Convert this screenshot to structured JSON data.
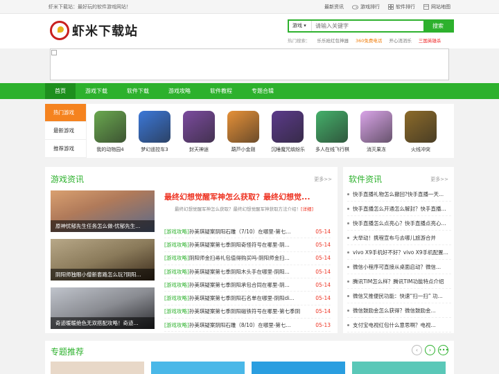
{
  "topbar": {
    "welcome": "虾米下载站：最好玩的软件游戏网站！",
    "links": [
      {
        "label": "最新资讯",
        "icon": "none"
      },
      {
        "label": "游戏排行",
        "icon": "gamepad-icon"
      },
      {
        "label": "软件排行",
        "icon": "apps-icon"
      },
      {
        "label": "网站地图",
        "icon": "sitemap-icon"
      }
    ]
  },
  "header": {
    "logo_text": "虾米下载站",
    "search": {
      "category": "游戏",
      "placeholder": "请输入关键字",
      "button": "搜索"
    },
    "hot": {
      "label": "热门搜索：",
      "words": [
        "乐乐抢红包神器",
        "360免费电话",
        "开心消消乐",
        "三国英雄杀"
      ]
    }
  },
  "nav": {
    "items": [
      "首页",
      "游戏下载",
      "软件下载",
      "游戏攻略",
      "软件教程",
      "专题合辑"
    ],
    "active": 0
  },
  "games_section": {
    "tabs": [
      "热门游戏",
      "最新游戏",
      "推荐游戏"
    ],
    "active_tab": 0,
    "games": [
      {
        "name": "我的动物园4",
        "color": "#6aa84f"
      },
      {
        "name": "梦幻遥控车3",
        "color": "#3c78d8"
      },
      {
        "name": "封天神途",
        "color": "#7b4b9e"
      },
      {
        "name": "葫芦小金刚",
        "color": "#e69138"
      },
      {
        "name": "沉睡魔咒缤纷乐",
        "color": "#5b3a8a"
      },
      {
        "name": "多人在线飞行棋",
        "color": "#45b06a"
      },
      {
        "name": "消灭果冻",
        "color": "#d9a4e8"
      },
      {
        "name": "火线冲突",
        "color": "#8c6b2a"
      }
    ]
  },
  "news": {
    "title": "游戏资讯",
    "more": "更多>>",
    "thumbs": [
      {
        "caption": "原神忧郁先生任务怎么做-忧郁先生...",
        "c1": "#c98a5a",
        "c2": "#6a5a7a"
      },
      {
        "caption": "阴阳师独眼小僧新套路怎么玩?阴阳...",
        "c1": "#8a7a5a",
        "c2": "#4a3a2a"
      },
      {
        "caption": "奇迹暖暖绝色无双搭配攻略！奇迹...",
        "c1": "#9aa0a8",
        "c2": "#3a3a3a"
      }
    ],
    "headline": "最终幻想觉醒军神怎么获取？最终幻想觉...",
    "summary": "最终幻想觉醒军神怎么获取？最终幻想觉醒军神获取方法介绍！",
    "summary_link": "[详细]",
    "items": [
      {
        "cat": "[游戏攻略]",
        "title": "孙美琪疑案阴阳石雕（7/10）在哪里-第七...",
        "date": "05-14"
      },
      {
        "cat": "[游戏攻略]",
        "title": "孙美琪疑案第七季阴阳奇怪符号在哪里-阴...",
        "date": "05-14"
      },
      {
        "cat": "[游戏攻略]",
        "title": "阴阳师金扫帚礼包值得购买吗-阴阳师金扫...",
        "date": "05-14"
      },
      {
        "cat": "[游戏攻略]",
        "title": "孙美琪疑案第七季阴阳木头手在哪里-阴阳...",
        "date": "05-14"
      },
      {
        "cat": "[游戏攻略]",
        "title": "孙美琪疑案第七季阴阳承包合同在哪里-阴...",
        "date": "05-14"
      },
      {
        "cat": "[游戏攻略]",
        "title": "孙美琪疑案第七季阴阳石名单在哪里-阴阳di...",
        "date": "05-14"
      },
      {
        "cat": "[游戏攻略]",
        "title": "孙美琪疑案第七季阴阳磁铁符号在哪里-第七季阴...",
        "date": "05-14"
      },
      {
        "cat": "[游戏攻略]",
        "title": "孙美琪疑案阴阳石雕（8/10）在哪里-第七...",
        "date": "05-13"
      }
    ]
  },
  "soft": {
    "title": "软件资讯",
    "more": "更多>>",
    "items": [
      "快手直播礼物怎么撤回?快手直播一天...",
      "快手直播怎么开通怎么解封？快手直播...",
      "快手直播怎么点亮心？快手直播点亮心...",
      "大举动！携程宣布与去哪儿旅游合并",
      "vivo X9手机好不好？vivo X9手机配置...",
      "微信小程序可直接从桌面启动？微信...",
      "腾讯TIM怎么样？腾讯TIM功能特点介绍",
      "微信又推便民功能：快速“扫一扫” 功...",
      "微信鼓励金怎么获得？微信鼓励金...",
      "支付宝电视红包什么意思啊？电视..."
    ]
  },
  "topics": {
    "title": "专题推荐",
    "prev": "‹",
    "next": "›",
    "dots": "•••",
    "cards": [
      "#e8d8c8",
      "#4ab8e8",
      "#2a9ee0",
      "#5ac8b8"
    ]
  },
  "colors": {
    "brand_green": "#2db12d",
    "accent_orange": "#f5831f",
    "date_red": "#ee3322"
  }
}
